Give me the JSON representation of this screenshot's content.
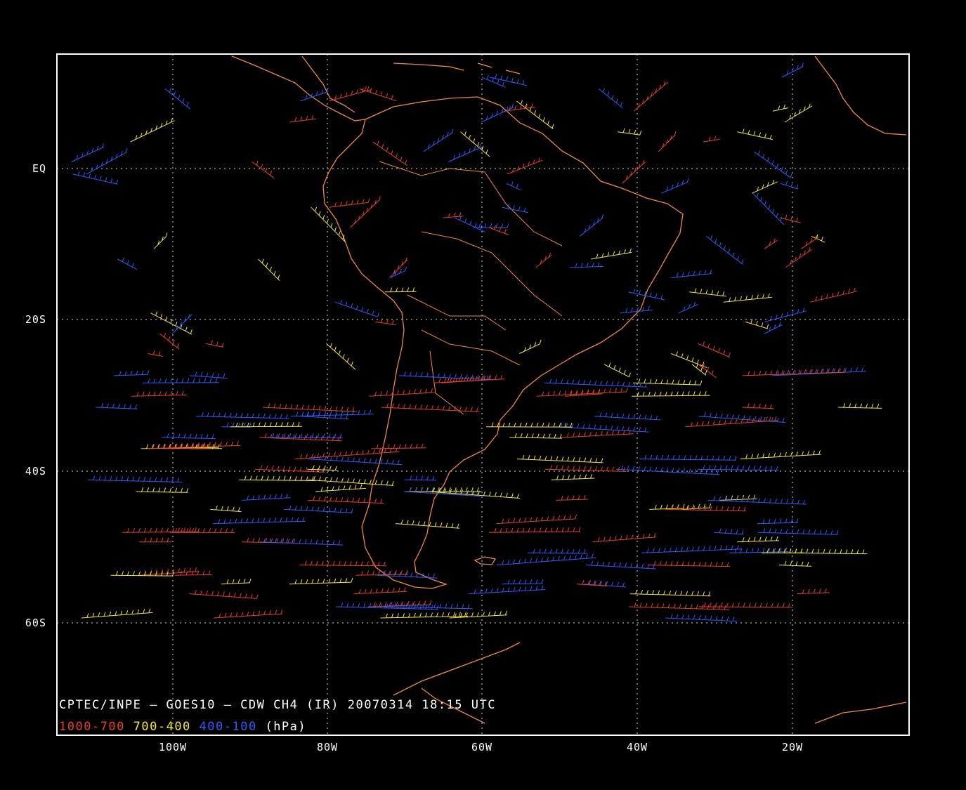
{
  "map": {
    "caption": "CPTEC/INPE — GOES10 — CDW CH4 (IR) 20070314 18:15 UTC",
    "legend": {
      "items": [
        {
          "label": "1000-700",
          "color": "#e8402a"
        },
        {
          "label": "700-400",
          "color": "#f5e63c"
        },
        {
          "label": "400-100",
          "color": "#2f5bff"
        }
      ],
      "unit": "(hPa)"
    },
    "lon_ticks": [
      "100W",
      "80W",
      "60W",
      "40W",
      "20W"
    ],
    "lat_ticks": [
      "EQ",
      "20S",
      "40S",
      "60S"
    ],
    "extent": {
      "lon_min": -115,
      "lon_max": -5,
      "lat_max": 15,
      "lat_min": -75
    },
    "colors": {
      "background": "#000000",
      "coastline": "#f08a3c",
      "grid": "#ffffff",
      "frame": "#ffffff"
    }
  }
}
